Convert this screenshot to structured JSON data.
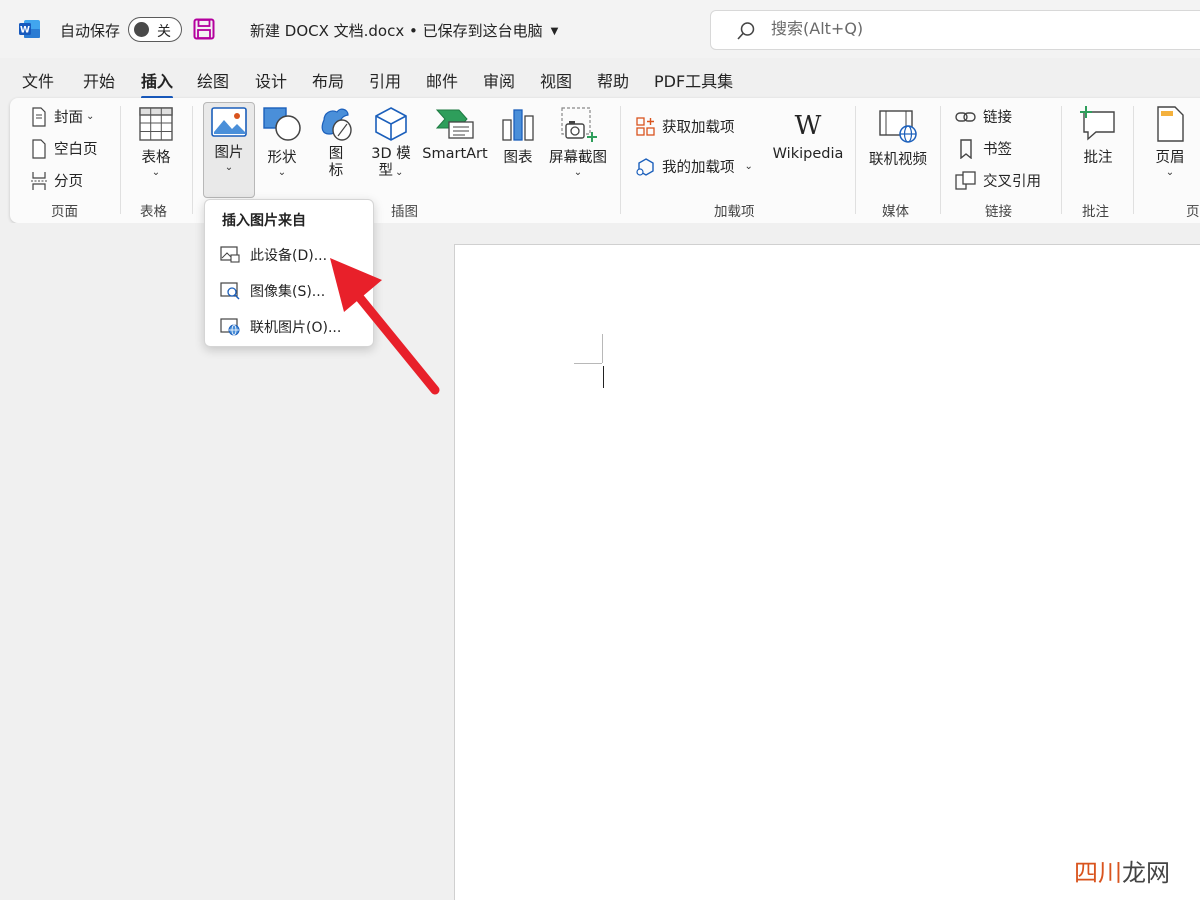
{
  "titlebar": {
    "autosave_label": "自动保存",
    "autosave_state": "关",
    "doc_title": "新建 DOCX 文档.docx • 已保存到这台电脑",
    "search_placeholder": "搜索(Alt+Q)"
  },
  "tabs": [
    {
      "label": "文件"
    },
    {
      "label": "开始"
    },
    {
      "label": "插入",
      "active": true
    },
    {
      "label": "绘图"
    },
    {
      "label": "设计"
    },
    {
      "label": "布局"
    },
    {
      "label": "引用"
    },
    {
      "label": "邮件"
    },
    {
      "label": "审阅"
    },
    {
      "label": "视图"
    },
    {
      "label": "帮助"
    },
    {
      "label": "PDF工具集"
    }
  ],
  "ribbon": {
    "pages": {
      "cover": "封面",
      "blank": "空白页",
      "break": "分页",
      "label": "页面"
    },
    "tables": {
      "table": "表格",
      "label": "表格"
    },
    "illustrations": {
      "picture": "图片",
      "shapes": "形状",
      "icons_1": "图",
      "icons_2": "标",
      "model_1": "3D 模",
      "model_2": "型",
      "smartart": "SmartArt",
      "chart": "图表",
      "screenshot": "屏幕截图",
      "label": "插图"
    },
    "addins": {
      "get": "获取加载项",
      "my": "我的加载项",
      "wikipedia": "Wikipedia",
      "label": "加载项"
    },
    "media": {
      "online_video": "联机视频",
      "label": "媒体"
    },
    "links": {
      "link": "链接",
      "bookmark": "书签",
      "cross_ref": "交叉引用",
      "label": "链接"
    },
    "comments": {
      "comment": "批注",
      "label": "批注"
    },
    "header_footer": {
      "header": "页眉",
      "label": "页"
    }
  },
  "dropdown": {
    "header": "插入图片来自",
    "items": [
      {
        "label": "此设备(D)..."
      },
      {
        "label": "图像集(S)..."
      },
      {
        "label": "联机图片(O)..."
      }
    ]
  },
  "watermark": {
    "main": "四川",
    "sub": "龙网"
  },
  "colors": {
    "accent": "#185abd",
    "arrow": "#e8202a",
    "word_blue": "#185abd"
  }
}
